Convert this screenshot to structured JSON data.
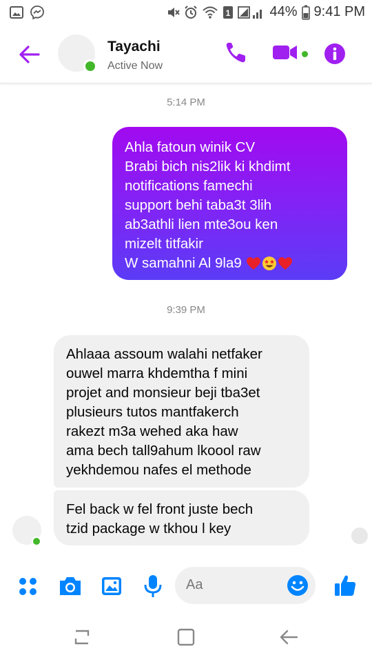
{
  "status_bar": {
    "battery": "44%",
    "time": "9:41 PM",
    "icons": [
      "image-icon",
      "messenger-icon",
      "mute-icon",
      "alarm-icon",
      "wifi-icon",
      "sim-icon",
      "signal-icon",
      "battery-icon"
    ]
  },
  "header": {
    "contact_name": "Tayachi",
    "status": "Active Now",
    "accent_color": "#a020f0",
    "online_color": "#42b72a"
  },
  "messages": {
    "timestamp_1": "5:14 PM",
    "sent_1": {
      "lines": [
        "Ahla fatoun winik CV",
        "Brabi bich nis2lik ki khdimt",
        "notifications famechi",
        "support behi taba3t 3lih",
        "ab3athli lien mte3ou ken",
        "mizelt titfakir",
        "W samahni Al 9la9"
      ],
      "emojis": [
        "heart",
        "star-struck",
        "heart"
      ]
    },
    "timestamp_2": "9:39 PM",
    "received_1": {
      "lines": [
        "Ahlaaa assoum walahi netfaker",
        "ouwel marra khdemtha f mini",
        "projet and monsieur beji tba3et",
        "plusieurs tutos mantfakerch",
        "rakezt m3a wehed aka haw",
        "ama bech tall9ahum lkoool raw",
        "yekhdemou nafes el methode"
      ]
    },
    "received_2": {
      "lines": [
        "Fel back w fel front juste  bech",
        "tzid package w tkhou l key"
      ]
    }
  },
  "composer": {
    "placeholder": "Aa",
    "icon_color": "#0084ff"
  }
}
